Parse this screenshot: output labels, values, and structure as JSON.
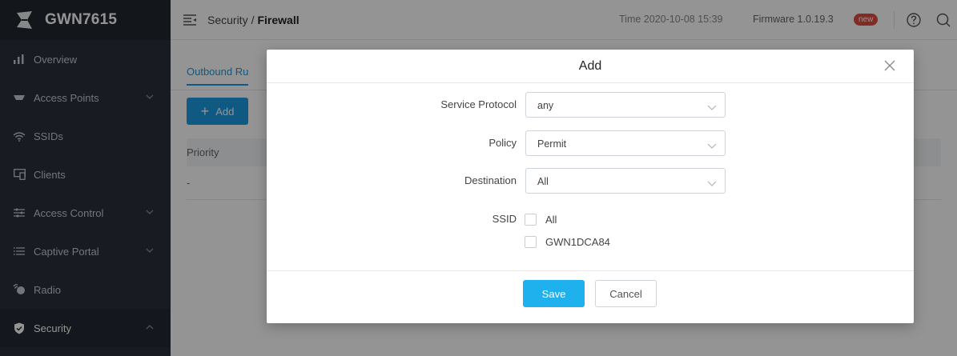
{
  "brand": {
    "name": "GWN7615",
    "logo_icon": "grandstream-logo-icon"
  },
  "sidebar": {
    "items": [
      {
        "label": "Overview",
        "icon": "bar-chart-icon",
        "expandable": false
      },
      {
        "label": "Access Points",
        "icon": "access-point-icon",
        "expandable": true
      },
      {
        "label": "SSIDs",
        "icon": "wifi-icon",
        "expandable": false
      },
      {
        "label": "Clients",
        "icon": "clients-icon",
        "expandable": false
      },
      {
        "label": "Access Control",
        "icon": "sliders-icon",
        "expandable": true
      },
      {
        "label": "Captive Portal",
        "icon": "list-icon",
        "expandable": true
      },
      {
        "label": "Radio",
        "icon": "radio-icon",
        "expandable": false
      },
      {
        "label": "Security",
        "icon": "shield-icon",
        "expandable": true,
        "active": true
      }
    ]
  },
  "header": {
    "breadcrumb_parent": "Security",
    "breadcrumb_sep": "/",
    "breadcrumb_current": "Firewall",
    "time": "Time 2020-10-08 15:39",
    "firmware": "Firmware 1.0.19.3",
    "firmware_badge": "new"
  },
  "content": {
    "tab_label": "Outbound Ru",
    "add_label": "Add",
    "table_header": "Priority",
    "table_cell": "-"
  },
  "dialog": {
    "title": "Add",
    "fields": {
      "service_protocol": {
        "label": "Service Protocol",
        "value": "any"
      },
      "policy": {
        "label": "Policy",
        "value": "Permit"
      },
      "destination": {
        "label": "Destination",
        "value": "All"
      }
    },
    "ssid": {
      "label": "SSID",
      "options": [
        {
          "label": "All",
          "checked": false
        },
        {
          "label": "GWN1DCA84",
          "checked": false
        }
      ]
    },
    "save_label": "Save",
    "cancel_label": "Cancel"
  },
  "colors": {
    "accent": "#1a9ae0",
    "save_button": "#1fb0ee",
    "sidebar_bg": "#2b303b",
    "badge": "#e04b3f"
  }
}
